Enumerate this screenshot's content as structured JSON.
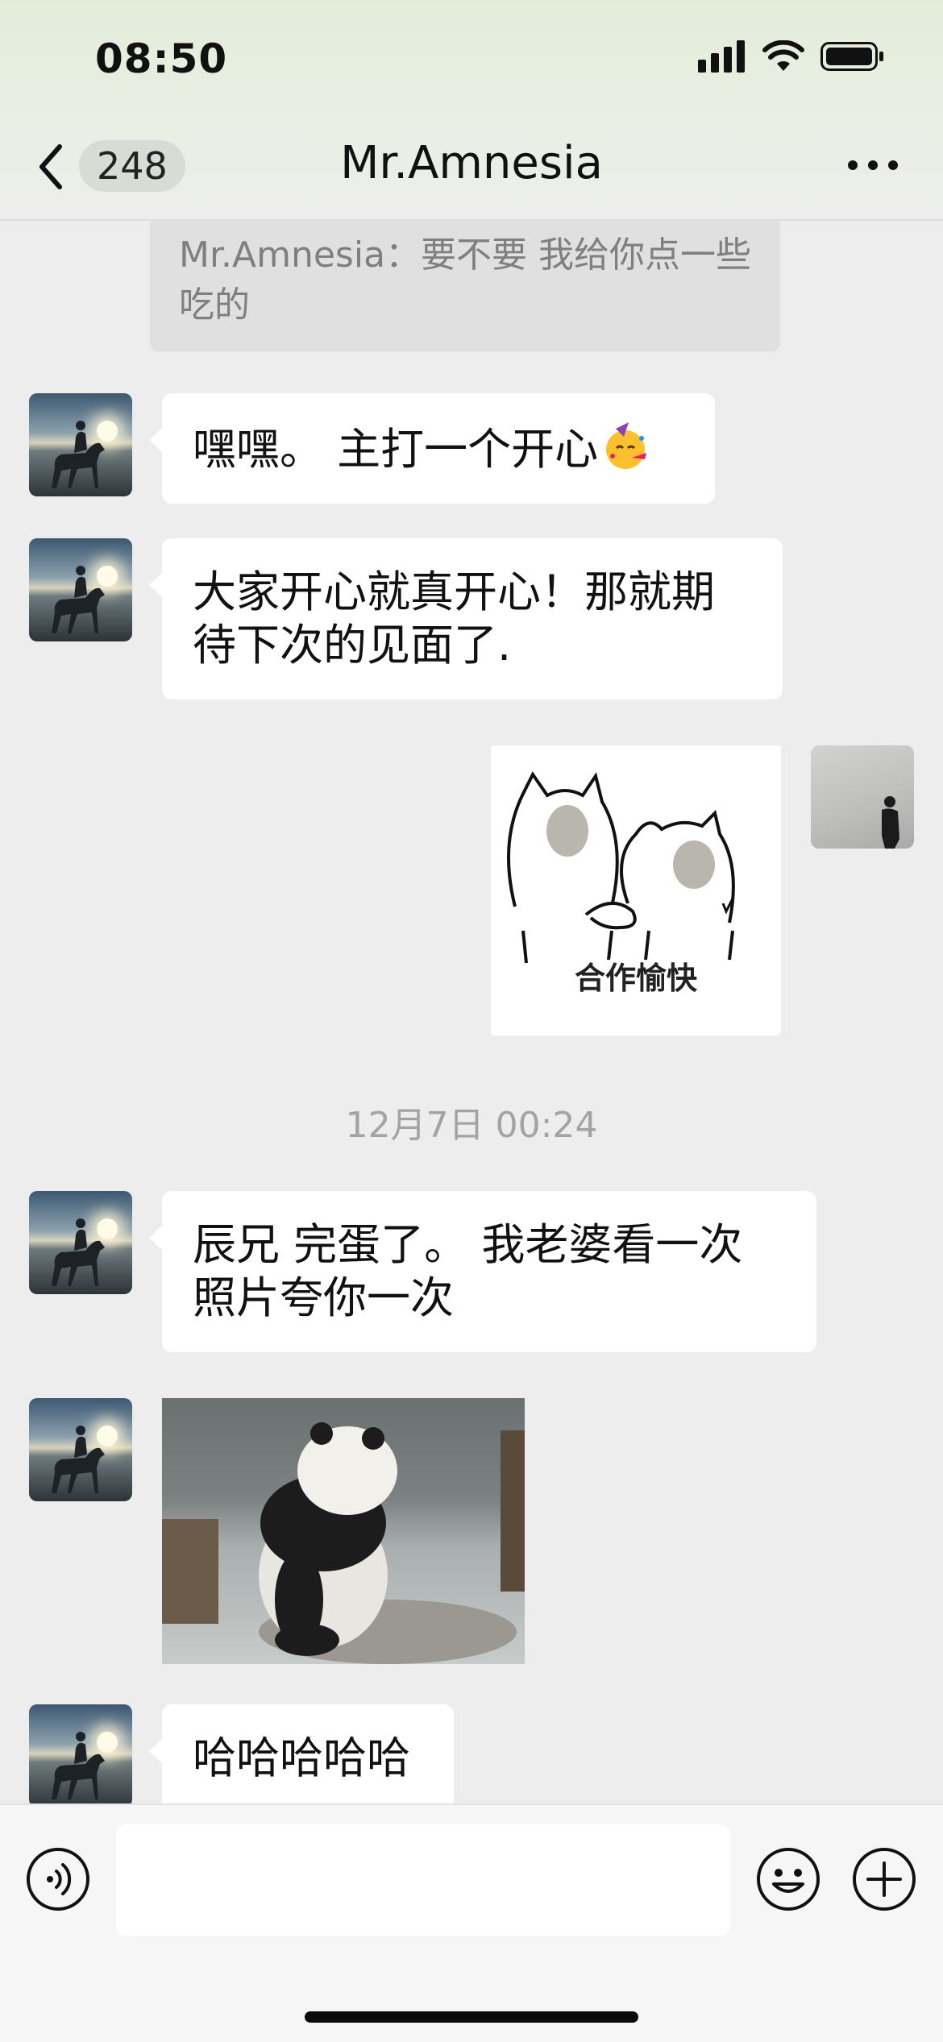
{
  "status": {
    "time": "08:50"
  },
  "nav": {
    "unread_count": "248",
    "title": "Mr.Amnesia"
  },
  "quote": {
    "text": "Mr.Amnesia：要不要 我给你点一些 吃的"
  },
  "messages": [
    {
      "text": "嘿嘿。 主打一个开心"
    },
    {
      "text": "大家开心就真开心！那就期待下次的见面了."
    },
    {
      "sticker_caption": "合作愉快"
    },
    {
      "text": "辰兄 完蛋了。 我老婆看一次照片夸你一次"
    },
    {
      "text": "哈哈哈哈哈"
    }
  ],
  "timestamp": "12月7日 00:24",
  "icons": {
    "back": "chevron-left-icon",
    "more": "more-dots-icon",
    "voice": "voice-icon",
    "emoji": "emoji-icon",
    "plus": "plus-icon",
    "party": "party-face-emoji"
  },
  "colors": {
    "bubble_in": "#ffffff",
    "background": "#ededed",
    "timestamp": "#a3a3a3"
  }
}
